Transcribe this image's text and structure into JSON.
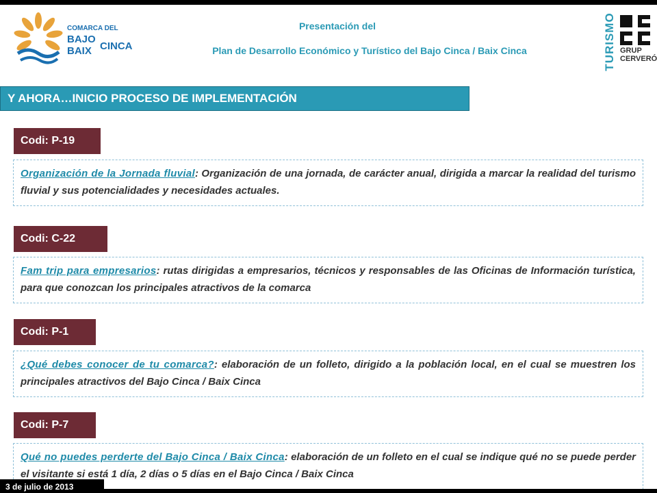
{
  "header": {
    "line1": "Presentación del",
    "line2": "Plan de Desarrollo Económico y Turístico del Bajo Cinca / Baix Cinca"
  },
  "logo_left": {
    "line1": "COMARCA DEL",
    "line2": "BAJO",
    "line3": "BAIX",
    "line4": "CINCA"
  },
  "logo_right": {
    "vertical_text": "TURISMO",
    "line1": "GRUP",
    "line2": "CERVERÓ"
  },
  "banner": {
    "text": "Y AHORA…INICIO PROCESO DE IMPLEMENTACIÓN"
  },
  "items": [
    {
      "code": "Codi: P-19",
      "title": "Organización de la Jornada fluvial",
      "text": ": Organización de una jornada, de carácter anual, dirigida a marcar la realidad del turismo fluvial y sus potencialidades y necesidades actuales."
    },
    {
      "code": "Codi: C-22",
      "title": "Fam trip para empresarios",
      "text": ": rutas dirigidas a empresarios, técnicos y responsables de las Oficinas de Información turística, para que conozcan los principales atractivos de la comarca"
    },
    {
      "code": "Codi: P-1",
      "title": "¿Qué debes conocer de tu comarca?",
      "text": ": elaboración de un folleto, dirigido a la población local, en el cual se muestren los principales atractivos del Bajo Cinca / Baix Cinca"
    },
    {
      "code": "Codi: P-7",
      "title": "Qué no puedes perderte del Bajo Cinca / Baix Cinca",
      "text": ": elaboración de un folleto en el cual se indique qué no se puede perder el visitante si está 1 día, 2 días o 5 días en el Bajo Cinca / Baix Cinca"
    }
  ],
  "footer": {
    "date": "3 de julio de 2013"
  },
  "colors": {
    "teal": "#2a9ab5",
    "maroon": "#6d2b35",
    "logo_orange": "#e8a33a",
    "logo_blue": "#1a6fb0"
  }
}
